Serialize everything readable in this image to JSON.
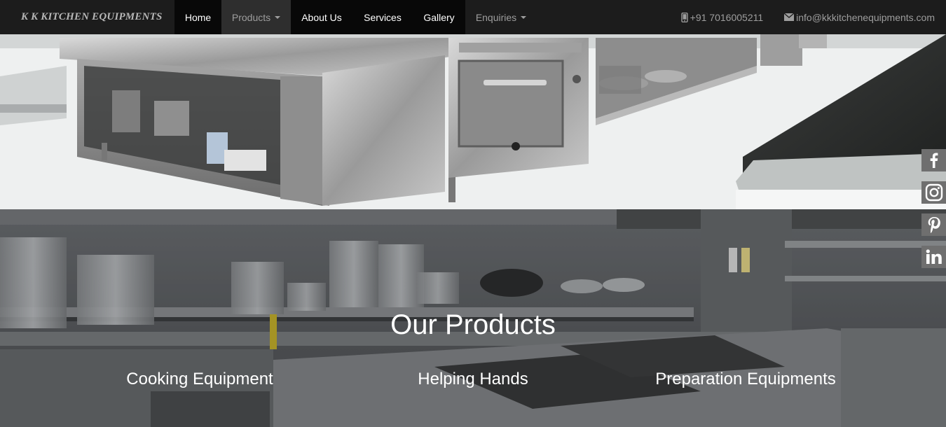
{
  "brand": "K K KITCHEN EQUIPMENTS",
  "nav": {
    "items": [
      {
        "label": "Home"
      },
      {
        "label": "Products"
      },
      {
        "label": "About Us"
      },
      {
        "label": "Services"
      },
      {
        "label": "Gallery"
      },
      {
        "label": "Enquiries"
      }
    ],
    "phone": "+91 7016005211",
    "email": "info@kkkitchenequipments.com"
  },
  "products": {
    "title": "Our Products",
    "categories": [
      {
        "label": "Cooking Equipment"
      },
      {
        "label": "Helping Hands"
      },
      {
        "label": "Preparation Equipments"
      }
    ]
  },
  "social": {
    "icons": [
      "facebook-icon",
      "instagram-icon",
      "pinterest-icon",
      "linkedin-icon"
    ]
  },
  "colors": {
    "navbar": "#1c1c1c",
    "nav_active": "#080808",
    "nav_muted_text": "#9d9d9d",
    "social_bg": "#6f6f6f"
  }
}
